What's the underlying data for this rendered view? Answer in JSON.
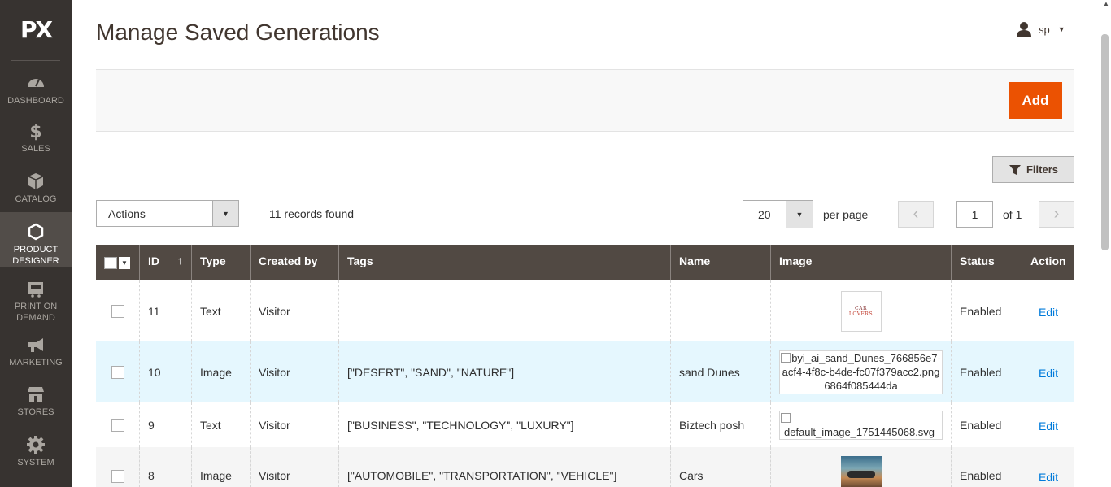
{
  "sidebar": {
    "logo": "PX",
    "items": [
      {
        "label": "Dashboard",
        "icon": "dashboard-icon"
      },
      {
        "label": "Sales",
        "icon": "dollar-icon"
      },
      {
        "label": "Catalog",
        "icon": "box-icon"
      },
      {
        "label": "Product Designer",
        "icon": "hexagon-icon"
      },
      {
        "label": "Print On Demand",
        "icon": "cart-icon"
      },
      {
        "label": "Marketing",
        "icon": "megaphone-icon"
      },
      {
        "label": "Stores",
        "icon": "store-icon"
      },
      {
        "label": "System",
        "icon": "gear-icon"
      }
    ],
    "active_index": 3
  },
  "header": {
    "title": "Manage Saved Generations",
    "user": "sp"
  },
  "toolbar": {
    "add_label": "Add",
    "filters_label": "Filters",
    "actions_label": "Actions",
    "records_found": "11 records found",
    "per_page_value": "20",
    "per_page_label": "per page",
    "page_value": "1",
    "page_of": "of 1"
  },
  "table": {
    "columns": [
      "ID",
      "Type",
      "Created by",
      "Tags",
      "Name",
      "Image",
      "Status",
      "Action"
    ],
    "sort_indicator": "↑",
    "rows": [
      {
        "id": "11",
        "type": "Text",
        "created_by": "Visitor",
        "tags": "",
        "name": "",
        "image_kind": "thumb-text",
        "image_text": [
          "CAR",
          "LOVERS"
        ],
        "status": "Enabled",
        "action": "Edit"
      },
      {
        "id": "10",
        "type": "Image",
        "created_by": "Visitor",
        "tags": "[\"DESERT\", \"SAND\", \"NATURE\"]",
        "name": "sand Dunes",
        "image_kind": "broken",
        "image_text": "byi_ai_sand_Dunes_766856e7-acf4-4f8c-b4de-fc07f379acc2.png6864f085444da",
        "status": "Enabled",
        "action": "Edit"
      },
      {
        "id": "9",
        "type": "Text",
        "created_by": "Visitor",
        "tags": "[\"BUSINESS\", \"TECHNOLOGY\", \"LUXURY\"]",
        "name": "Biztech posh",
        "image_kind": "broken",
        "image_text": "default_image_1751445068.svg",
        "status": "Enabled",
        "action": "Edit"
      },
      {
        "id": "8",
        "type": "Image",
        "created_by": "Visitor",
        "tags": "[\"AUTOMOBILE\", \"TRANSPORTATION\", \"VEHICLE\"]",
        "name": "Cars",
        "image_kind": "thumb-photo",
        "image_text": "",
        "status": "Enabled",
        "action": "Edit"
      }
    ]
  },
  "colors": {
    "sidebar_bg": "#373330",
    "accent": "#eb5202",
    "table_header": "#514943",
    "link": "#007bdb",
    "highlight_row": "#e5f7fe"
  }
}
